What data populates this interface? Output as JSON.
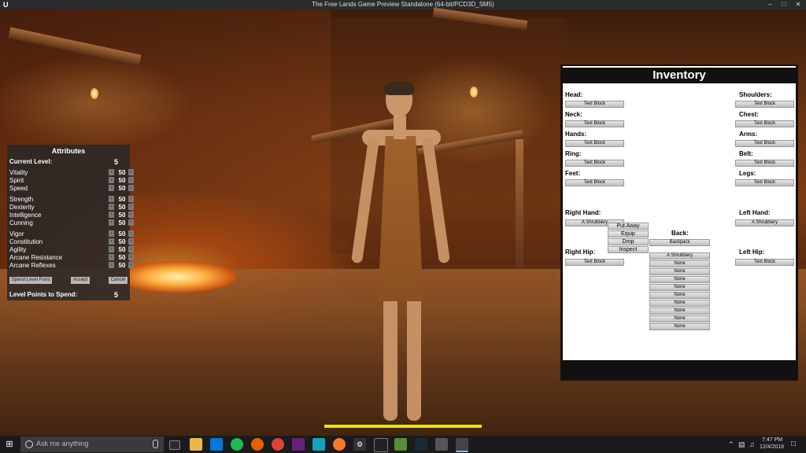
{
  "window": {
    "title": "The Free Lands Game Preview Standalone (64-bit/PCD3D_SM5)"
  },
  "attributes": {
    "title": "Attributes",
    "current_level_label": "Current Level:",
    "current_level": "5",
    "stats_group1": [
      {
        "label": "Vitality",
        "value": "50"
      },
      {
        "label": "Spirit",
        "value": "50"
      },
      {
        "label": "Speed",
        "value": "50"
      }
    ],
    "stats_group2": [
      {
        "label": "Strength",
        "value": "50"
      },
      {
        "label": "Dexterity",
        "value": "50"
      },
      {
        "label": "Intelligence",
        "value": "50"
      },
      {
        "label": "Cunning",
        "value": "50"
      }
    ],
    "stats_group3": [
      {
        "label": "Vigor",
        "value": "50"
      },
      {
        "label": "Constitution",
        "value": "50"
      },
      {
        "label": "Agility",
        "value": "50"
      },
      {
        "label": "Arcane Resistance",
        "value": "50"
      },
      {
        "label": "Arcane Reflexes",
        "value": "50"
      }
    ],
    "spend_button": "Spend Level Point",
    "accept_button": "Accept",
    "cancel_button": "Cancel",
    "points_label": "Level Points to Spend:",
    "points_value": "5"
  },
  "inventory": {
    "title": "Inventory",
    "left_slots": [
      {
        "label": "Head:",
        "item": "Text Block"
      },
      {
        "label": "Neck:",
        "item": "Text Block"
      },
      {
        "label": "Hands:",
        "item": "Text Block"
      },
      {
        "label": "Ring:",
        "item": "Text Block"
      },
      {
        "label": "Feet:",
        "item": "Text Block"
      }
    ],
    "right_slots": [
      {
        "label": "Shoulders:",
        "item": "Text Block"
      },
      {
        "label": "Chest:",
        "item": "Text Block"
      },
      {
        "label": "Arms:",
        "item": "Text Block"
      },
      {
        "label": "Belt:",
        "item": "Text Block"
      },
      {
        "label": "Legs:",
        "item": "Text Block"
      }
    ],
    "right_hand_label": "Right Hand:",
    "right_hand_item": "A Shrubbery",
    "left_hand_label": "Left Hand:",
    "left_hand_item": "A Shrubbery",
    "right_hip_label": "Right Hip:",
    "right_hip_item": "Text Block",
    "left_hip_label": "Left Hip:",
    "left_hip_item": "Text Block",
    "back_label": "Back:",
    "back_item": "Backpack",
    "context_menu": [
      "Put Away",
      "Equip",
      "Drop",
      "Inspect"
    ],
    "backpack_items": [
      "A Shrubbery",
      "None",
      "None",
      "None",
      "None",
      "None",
      "None",
      "None",
      "None",
      "None"
    ]
  },
  "health": {
    "fraction": 1.0,
    "color": "#e6e600"
  },
  "taskbar": {
    "search_placeholder": "Ask me anything",
    "time": "7:47 PM",
    "date": "12/4/2016"
  }
}
